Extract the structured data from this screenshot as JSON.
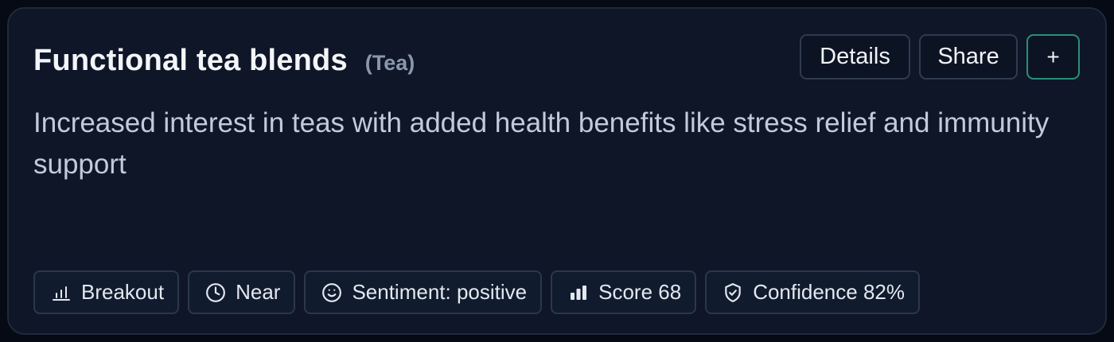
{
  "card": {
    "title": "Functional tea blends",
    "category": "(Tea)",
    "description": "Increased interest in teas with added health benefits like stress relief and immunity support",
    "actions": {
      "details_label": "Details",
      "share_label": "Share",
      "add_label": "+"
    },
    "chips": [
      {
        "icon": "bar-chart-icon",
        "label": "Breakout"
      },
      {
        "icon": "clock-icon",
        "label": "Near"
      },
      {
        "icon": "smile-icon",
        "label": "Sentiment: positive"
      },
      {
        "icon": "signal-bars-icon",
        "label": "Score 68"
      },
      {
        "icon": "shield-check-icon",
        "label": "Confidence 82%"
      }
    ]
  },
  "colors": {
    "background": "#060a14",
    "card": "#0e1628",
    "accent_border": "#2a8f78",
    "title": "#f3f5f8",
    "muted": "#8b97ab"
  }
}
